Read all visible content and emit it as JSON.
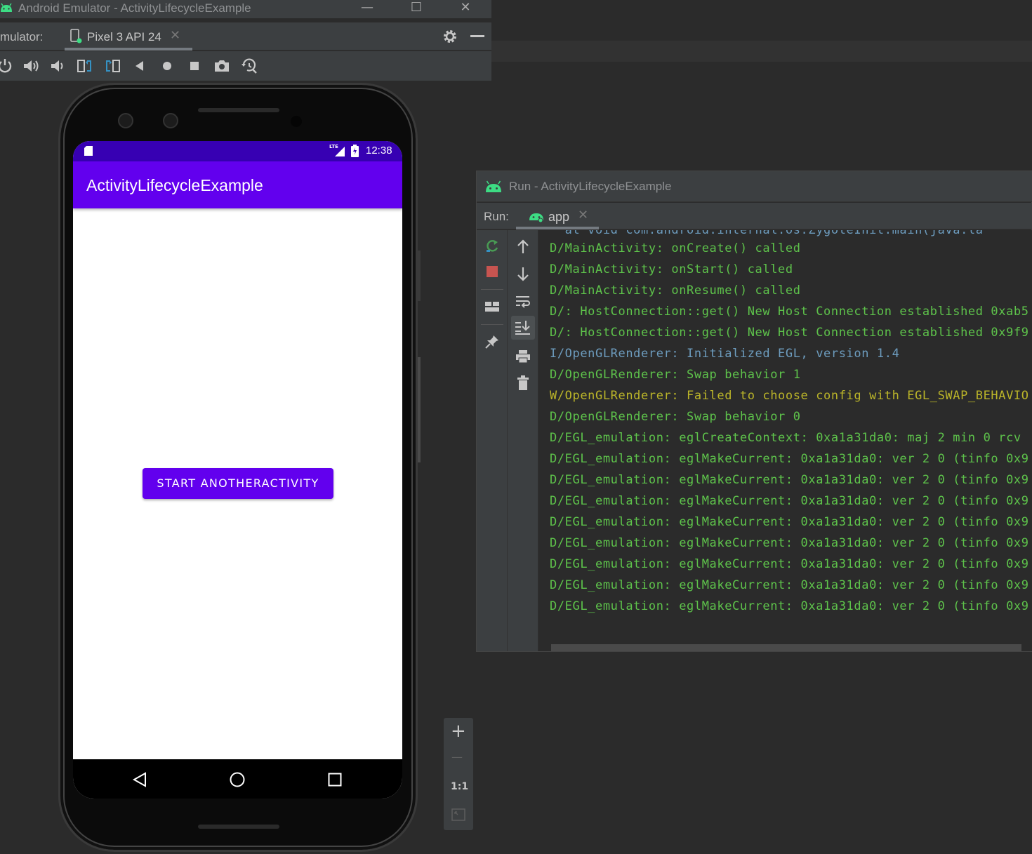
{
  "emulator": {
    "title": "Android Emulator - ActivityLifecycleExample",
    "win_min": "—",
    "win_max": "☐",
    "win_close": "✕",
    "label": "mulator:",
    "tab": "Pixel 3 API 24",
    "tab_close": "✕"
  },
  "phone": {
    "status_time": "12:38",
    "status_net": "LTE",
    "app_title": "ActivityLifecycleExample",
    "button_label": "START ANOTHERACTIVITY"
  },
  "zoom": {
    "plus": "+",
    "minus": "—",
    "one_to_one": "1:1"
  },
  "run_window": {
    "title": "Run - ActivityLifecycleExample",
    "label": "Run:",
    "tab": "app",
    "tab_close": "✕"
  },
  "log": {
    "cut_line": "  at void com.android.internal.os.ZygoteInit.main(java.la",
    "lines": [
      {
        "text": "D/MainActivity: onCreate() called",
        "color": "#5ec34b"
      },
      {
        "text": "D/MainActivity: onStart() called",
        "color": "#5ec34b"
      },
      {
        "text": "D/MainActivity: onResume() called",
        "color": "#5ec34b"
      },
      {
        "text": "D/: HostConnection::get() New Host Connection established 0xab5",
        "color": "#5ec34b"
      },
      {
        "text": "D/: HostConnection::get() New Host Connection established 0x9f9",
        "color": "#5ec34b"
      },
      {
        "text": "I/OpenGLRenderer: Initialized EGL, version 1.4",
        "color": "#6d9cbe"
      },
      {
        "text": "D/OpenGLRenderer: Swap behavior 1",
        "color": "#5ec34b"
      },
      {
        "text": "W/OpenGLRenderer: Failed to choose config with EGL_SWAP_BEHAVIO",
        "color": "#bbb529"
      },
      {
        "text": "D/OpenGLRenderer: Swap behavior 0",
        "color": "#5ec34b"
      },
      {
        "text": "D/EGL_emulation: eglCreateContext: 0xa1a31da0: maj 2 min 0 rcv",
        "color": "#5ec34b"
      },
      {
        "text": "D/EGL_emulation: eglMakeCurrent: 0xa1a31da0: ver 2 0 (tinfo 0x9",
        "color": "#5ec34b"
      },
      {
        "text": "D/EGL_emulation: eglMakeCurrent: 0xa1a31da0: ver 2 0 (tinfo 0x9",
        "color": "#5ec34b"
      },
      {
        "text": "D/EGL_emulation: eglMakeCurrent: 0xa1a31da0: ver 2 0 (tinfo 0x9",
        "color": "#5ec34b"
      },
      {
        "text": "D/EGL_emulation: eglMakeCurrent: 0xa1a31da0: ver 2 0 (tinfo 0x9",
        "color": "#5ec34b"
      },
      {
        "text": "D/EGL_emulation: eglMakeCurrent: 0xa1a31da0: ver 2 0 (tinfo 0x9",
        "color": "#5ec34b"
      },
      {
        "text": "D/EGL_emulation: eglMakeCurrent: 0xa1a31da0: ver 2 0 (tinfo 0x9",
        "color": "#5ec34b"
      },
      {
        "text": "D/EGL_emulation: eglMakeCurrent: 0xa1a31da0: ver 2 0 (tinfo 0x9",
        "color": "#5ec34b"
      },
      {
        "text": "D/EGL_emulation: eglMakeCurrent: 0xa1a31da0: ver 2 0 (tinfo 0x9",
        "color": "#5ec34b"
      }
    ]
  },
  "icons": {
    "toolbar": [
      "power-icon",
      "volume-up-icon",
      "volume-down-icon",
      "rotate-left-icon",
      "rotate-right-icon",
      "back-icon",
      "home-icon",
      "overview-icon",
      "camera-icon",
      "zoom-history-icon"
    ],
    "run_gutter": [
      "rerun-icon",
      "stop-icon",
      "layout-icon",
      "pin-icon"
    ],
    "console_gutter": [
      "scroll-up-icon",
      "scroll-down-icon",
      "soft-wrap-icon",
      "scroll-to-end-icon",
      "print-icon",
      "trash-icon"
    ]
  },
  "colors": {
    "accent": "#6200ee",
    "status_bar": "#3700b3",
    "ide_bg": "#2b2b2b",
    "panel": "#3c3f41",
    "android_green": "#3ddc84"
  }
}
